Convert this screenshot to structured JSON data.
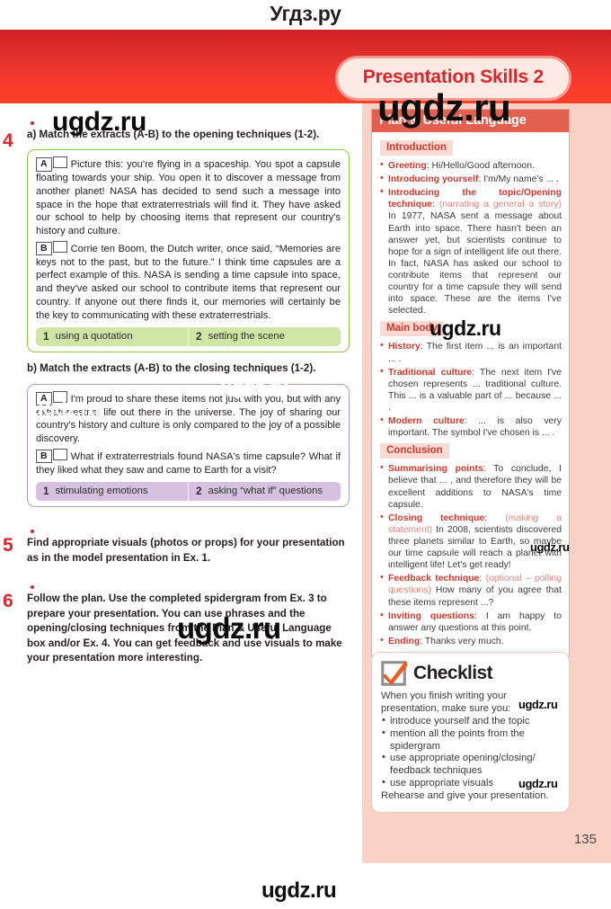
{
  "site": {
    "brand_top": "Угдз.ру",
    "brand_bottom": "ugdz.ru",
    "watermark": "ugdz.ru"
  },
  "header": {
    "title": "Presentation Skills 2"
  },
  "page": {
    "number": "135"
  },
  "exercises": [
    {
      "number": "4",
      "prompt_a": "a)  Match the extracts (A-B) to the opening techniques (1-2).",
      "prompt_b": "b)  Match the extracts (A-B) to the closing techniques (1-2).",
      "box_a": {
        "extract_a_letter": "A",
        "extract_a_text": "Picture this: you're flying in a spaceship. You spot a capsule floating towards your ship. You open it to discover a message from another planet! NASA has decided to send such a message into space in the hope that extraterrestrials will find it. They have asked our school to help by choosing items that represent our country's history and culture.",
        "extract_b_letter": "B",
        "extract_b_text": "Corrie ten Boom, the Dutch writer, once said, “Memories are keys not to the past, but to the future.” I think time capsules are a perfect example of this. NASA is sending a time capsule into space, and they've asked our school to contribute items that represent our country. If anyone out there finds it, our memories will certainly be the key to communicating with these extraterrestrials.",
        "options": [
          {
            "n": "1",
            "label": "using a quotation"
          },
          {
            "n": "2",
            "label": "setting the scene"
          }
        ]
      },
      "box_b": {
        "extract_a_letter": "A",
        "extract_a_text": "I'm proud to share these items not just with you, but with any extraterrestrial life out there in the universe. The joy of sharing our country's history and culture is only compared to the joy of a possible discovery.",
        "extract_b_letter": "B",
        "extract_b_text": "What if extraterrestrials found NASA's time capsule? What if they liked what they saw and came to Earth for a visit?",
        "options": [
          {
            "n": "1",
            "label": "stimulating emotions"
          },
          {
            "n": "2",
            "label": "asking “what if” questions"
          }
        ]
      }
    },
    {
      "number": "5",
      "text": "Find appropriate visuals (photos or props) for your presentation as in the model presentation in Ex. 1."
    },
    {
      "number": "6",
      "text": "Follow the plan. Use the completed spidergram from Ex. 3 to prepare your presentation. You can use phrases and the opening/closing techniques from the Plan & Useful Language box and/or Ex. 4. You can get feedback and use visuals to make your presentation more interesting."
    }
  ],
  "plan_box": {
    "heading": "Plan & Useful Language",
    "sections": [
      {
        "tag": "Introduction",
        "items": [
          {
            "label": "Greeting",
            "body": "Hi/Hello/Good afternoon.",
            "paren": ""
          },
          {
            "label": "Introducing yourself",
            "body": "I'm/My name's ... .",
            "paren": ""
          },
          {
            "label": "Introducing the topic/Opening technique",
            "paren": "(narrating a general a story)",
            "body": "In 1977, NASA sent a message about Earth into space. There hasn't been an answer yet, but scientists continue to hope for a sign of intelligent life out there. In fact, NASA has asked our school to contribute items that represent our country for a time capsule they will send into space. These are the items I've selected."
          }
        ]
      },
      {
        "tag": "Main body",
        "items": [
          {
            "label": "History",
            "paren": "",
            "body": "The first item ... is an important ... ."
          },
          {
            "label": "Traditional culture",
            "paren": "",
            "body": "The next item I've chosen represents ... traditional culture. This ... is a valuable part of ... because ... ."
          },
          {
            "label": "Modern culture",
            "paren": "",
            "body": "... is also very important. The symbol I've chosen is ... ."
          }
        ]
      },
      {
        "tag": "Conclusion",
        "items": [
          {
            "label": "Summarising points",
            "paren": "",
            "body": "To conclude, I believe that ... , and therefore they will be excellent additions to NASA's time capsule."
          },
          {
            "label": "Closing technique",
            "paren": "(making a statement)",
            "body": "In 2008, scientists discovered three planets similar to Earth, so maybe our time capsule will reach a planet with intelligent life! Let's get ready!"
          },
          {
            "label": "Feedback technique",
            "paren": "(optional – polling questions)",
            "body": "How many of you agree that these items represent ...?"
          },
          {
            "label": "Inviting questions",
            "paren": "",
            "body": "I am happy to answer any questions at this point."
          },
          {
            "label": "Ending",
            "paren": "",
            "body": "Thanks very much."
          }
        ]
      }
    ]
  },
  "checklist": {
    "title": "Checklist",
    "intro": "When you finish writing your presentation, make sure you:",
    "items": [
      "introduce yourself and the topic",
      "mention all the points from the spidergram",
      "use appropriate opening/closing/ feedback techniques",
      "use appropriate visuals"
    ],
    "outro": "Rehearse and give your presentation."
  },
  "colors": {
    "header_red": "#e8342c",
    "title_red": "#d8262c",
    "pink_panel": "#fad2c5",
    "plan_head": "#e2604f",
    "green_border": "#8cc63f",
    "purple_border": "#b49ac4"
  }
}
